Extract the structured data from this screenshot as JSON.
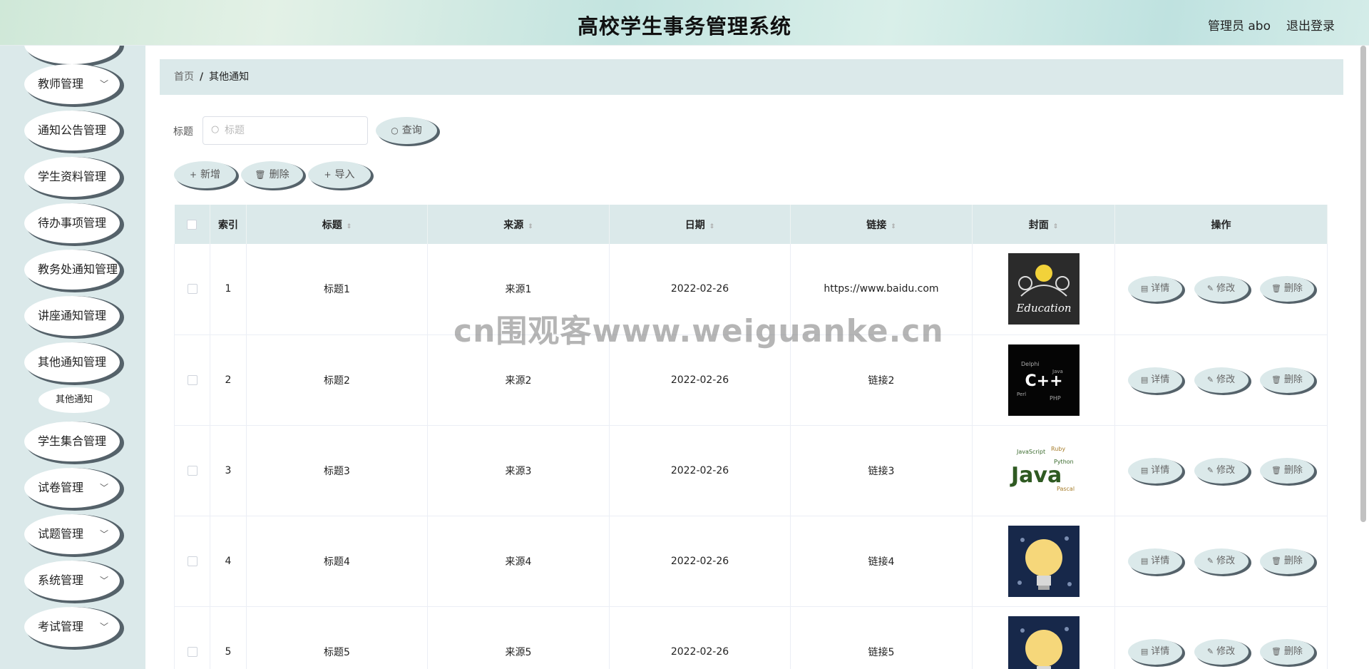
{
  "header": {
    "title": "高校学生事务管理系统",
    "user": "管理员 abo",
    "logout": "退出登录"
  },
  "sidebar": {
    "items": [
      {
        "label": "",
        "arrow": ""
      },
      {
        "label": "教师管理",
        "arrow": "﹀"
      },
      {
        "label": "通知公告管理",
        "arrow": ""
      },
      {
        "label": "学生资料管理",
        "arrow": ""
      },
      {
        "label": "待办事项管理",
        "arrow": ""
      },
      {
        "label": "教务处通知管理",
        "arrow": ""
      },
      {
        "label": "讲座通知管理",
        "arrow": ""
      },
      {
        "label": "其他通知管理",
        "arrow": ""
      },
      {
        "label": "学生集合管理",
        "arrow": ""
      },
      {
        "label": "试卷管理",
        "arrow": "﹀"
      },
      {
        "label": "试题管理",
        "arrow": "﹀"
      },
      {
        "label": "系统管理",
        "arrow": "﹀"
      },
      {
        "label": "考试管理",
        "arrow": "﹀"
      }
    ],
    "sub_item": "其他通知"
  },
  "breadcrumb": {
    "home": "首页",
    "sep": "/",
    "current": "其他通知"
  },
  "search": {
    "label": "标题",
    "placeholder": "标题",
    "icon": "search-icon",
    "query_label": "查询"
  },
  "toolbar": {
    "add_label": "新增",
    "delete_label": "删除",
    "import_label": "导入"
  },
  "table": {
    "columns": [
      "索引",
      "标题",
      "来源",
      "日期",
      "链接",
      "封面",
      "操作"
    ],
    "rows": [
      {
        "index": "1",
        "title": "标题1",
        "source": "来源1",
        "date": "2022-02-26",
        "link": "https://www.baidu.com",
        "cover": "education"
      },
      {
        "index": "2",
        "title": "标题2",
        "source": "来源2",
        "date": "2022-02-26",
        "link": "链接2",
        "cover": "cpp"
      },
      {
        "index": "3",
        "title": "标题3",
        "source": "来源3",
        "date": "2022-02-26",
        "link": "链接3",
        "cover": "java"
      },
      {
        "index": "4",
        "title": "标题4",
        "source": "来源4",
        "date": "2022-02-26",
        "link": "链接4",
        "cover": "bulb"
      },
      {
        "index": "5",
        "title": "标题5",
        "source": "来源5",
        "date": "2022-02-26",
        "link": "链接5",
        "cover": "bulb"
      }
    ],
    "actions": {
      "detail": "详情",
      "edit": "修改",
      "delete": "删除"
    }
  },
  "cover_text": {
    "education": "Education",
    "cpp": "C++",
    "java": "Java"
  },
  "watermark": "cn围观客www.weiguanke.cn",
  "colors": {
    "accent": "#dbe9ea",
    "shadow": "#55626a"
  }
}
